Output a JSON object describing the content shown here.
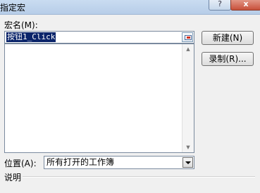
{
  "window": {
    "title": "指定宏",
    "help_icon": "?",
    "close_icon": "x"
  },
  "macro_name": {
    "label": "宏名(M):",
    "value": "按钮1_Click"
  },
  "macro_list": {
    "items": []
  },
  "buttons": {
    "new_label": "新建(N)",
    "record_label": "录制(R)..."
  },
  "location": {
    "label": "位置(A):",
    "selected": "所有打开的工作簿"
  },
  "description": {
    "label": "说明"
  },
  "icons": {
    "help": "help-icon",
    "close": "close-icon",
    "ref": "collapse-dialog-icon",
    "dropdown": "chevron-down-icon"
  }
}
